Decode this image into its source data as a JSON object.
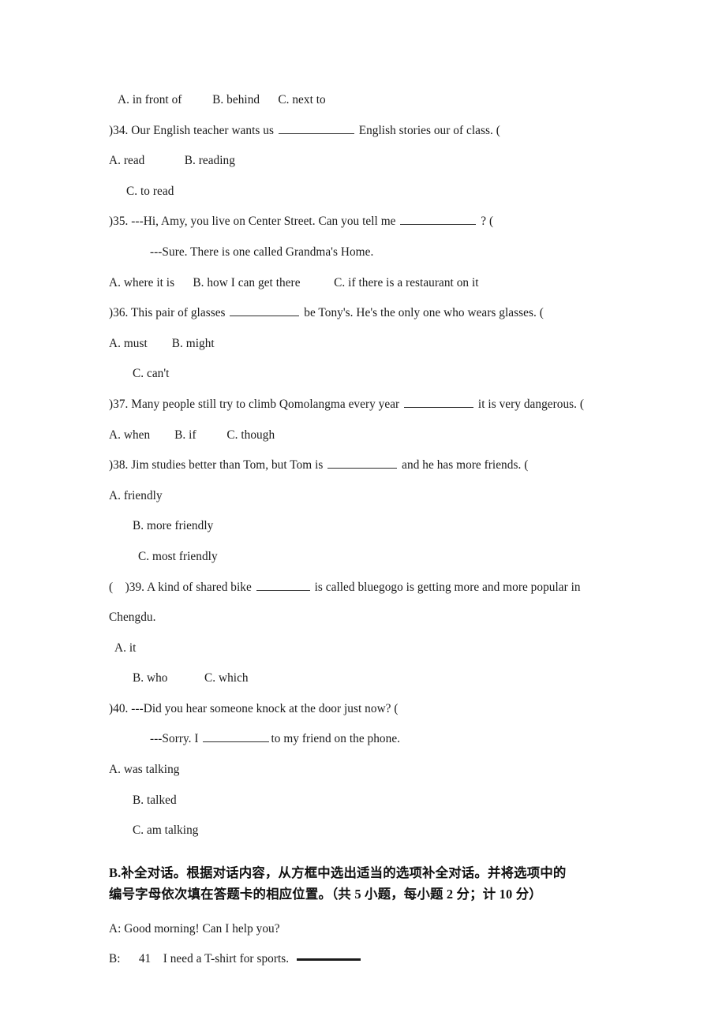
{
  "document": {
    "type": "exam-paper-page",
    "language_note": "English grammar multiple-choice exam, Chinese instructions"
  },
  "lines": [
    {
      "id": "q33-options",
      "indent": "ind-2",
      "text": "A. in front of          B. behind      C. next to"
    },
    {
      "id": "q34-stem-a",
      "indent": "",
      "pre": ")34. Our English teacher wants us ",
      "blank": "w-long",
      "post": " English stories our of class. ("
    },
    {
      "id": "q34-options-ab",
      "indent": "",
      "text": "A. read             B. reading"
    },
    {
      "id": "q34-options-c",
      "indent": "ind-3",
      "text": "C. to read"
    },
    {
      "id": "q35-stem",
      "indent": "",
      "pre": ")35. ---Hi, Amy, you live on Center Street. Can you tell me ",
      "blank": "w-long",
      "post": " ? ("
    },
    {
      "id": "q35-reply",
      "indent": "ind-6",
      "text": "---Sure. There is one called Grandma's Home."
    },
    {
      "id": "q35-options",
      "indent": "",
      "text": "A. where it is      B. how I can get there           C. if there is a restaurant on it"
    },
    {
      "id": "q36-stem",
      "indent": "",
      "pre": ")36. This pair of glasses ",
      "blank": "w-mid",
      "post": " be Tony's. He's the only one who wears glasses. ("
    },
    {
      "id": "q36-options-ab",
      "indent": "",
      "text": "A. must        B. might"
    },
    {
      "id": "q36-options-c",
      "indent": "ind-4",
      "text": "C. can't"
    },
    {
      "id": "q37-stem",
      "indent": "",
      "pre": ")37. Many people still try to climb Qomolangma every year ",
      "blank": "w-mid",
      "post": " it is very dangerous. ("
    },
    {
      "id": "q37-options",
      "indent": "",
      "text": "A. when        B. if          C. though"
    },
    {
      "id": "q38-stem",
      "indent": "",
      "pre": ")38. Jim studies better than Tom, but Tom is ",
      "blank": "w-mid",
      "post": " and he has more friends. ("
    },
    {
      "id": "q38-options-a",
      "indent": "",
      "text": "A. friendly"
    },
    {
      "id": "q38-options-b",
      "indent": "ind-4",
      "text": "B. more friendly"
    },
    {
      "id": "q38-options-c",
      "indent": "ind-5",
      "text": "C. most friendly"
    },
    {
      "id": "q39-stem",
      "indent": "",
      "pre": "(    )39. A kind of shared bike ",
      "blank": "w-short",
      "post": " is called bluegogo is getting more and more popular in"
    },
    {
      "id": "q39-stem-cont",
      "indent": "",
      "text": "Chengdu."
    },
    {
      "id": "q39-options-a",
      "indent": "ind-1",
      "text": "A. it"
    },
    {
      "id": "q39-options-bc",
      "indent": "ind-4",
      "text": "B. who            C. which"
    },
    {
      "id": "q40-stem",
      "indent": "",
      "text": ")40. ---Did you hear someone knock at the door just now? ("
    },
    {
      "id": "q40-reply",
      "indent": "ind-6",
      "pre": "---Sorry. I ",
      "blank": "w-tiny",
      "post": "to my friend on the phone."
    },
    {
      "id": "q40-options-a",
      "indent": "",
      "text": "A. was talking"
    },
    {
      "id": "q40-options-b",
      "indent": "ind-4",
      "text": "B. talked"
    },
    {
      "id": "q40-options-c",
      "indent": "ind-4",
      "text": "C. am talking"
    }
  ],
  "section_b": {
    "label": "B.",
    "instruction_line_1": "补全对话。根据对话内容，从方框中选出适当的选项补全对话。并将选项中的",
    "instruction_line_2": "编号字母依次填在答题卡的相应位置。",
    "scoring": "（共 5 小题，每小题 2 分；计 10 分）"
  },
  "dialogue": {
    "speaker_a_line": "A: Good morning! Can I help you?",
    "speaker_b_label": "B:",
    "blank_number": "41",
    "speaker_b_text": "I need a T-shirt for sports."
  }
}
